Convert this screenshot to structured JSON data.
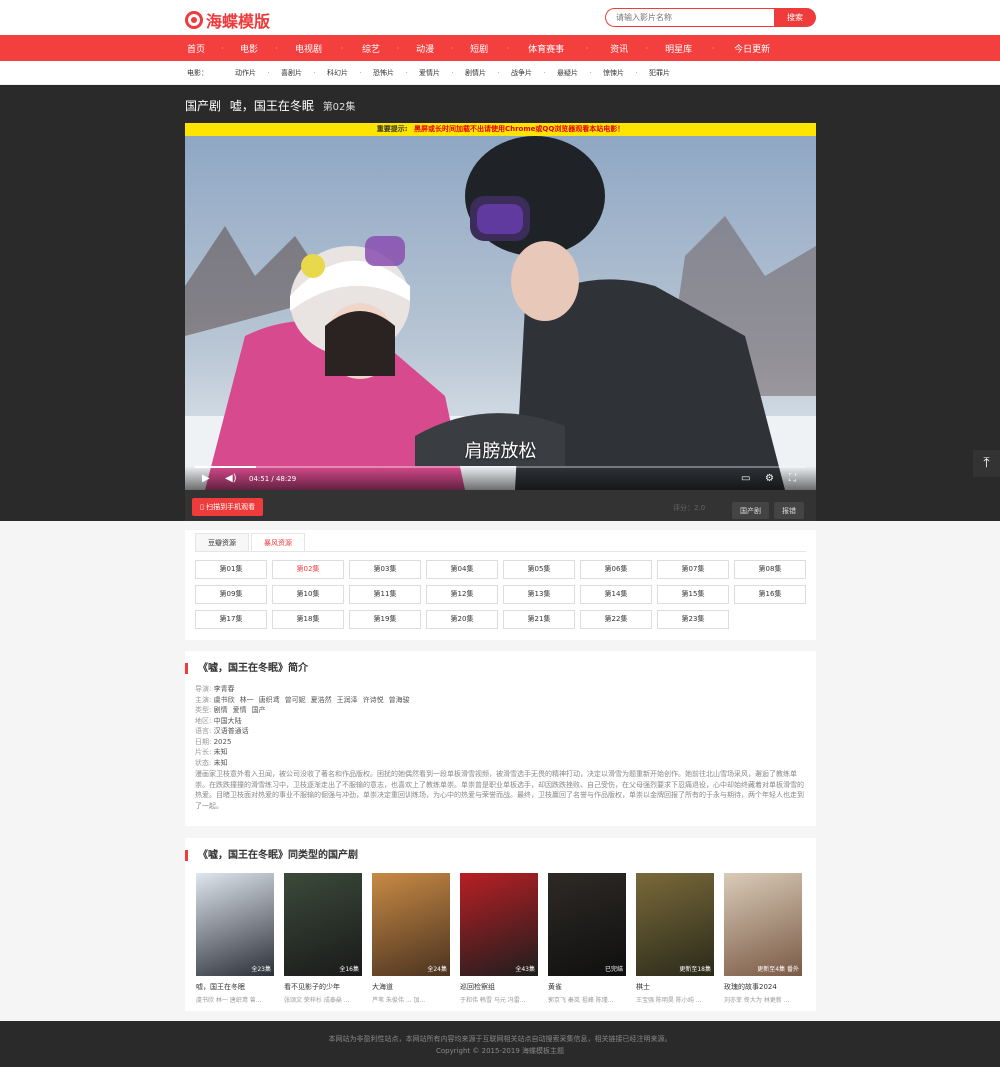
{
  "header": {
    "logo_text": "海蝶模版",
    "search_placeholder": "请输入影片名称",
    "search_button": "搜索"
  },
  "nav": [
    "首页",
    "电影",
    "电视剧",
    "综艺",
    "动漫",
    "短剧",
    "体育赛事",
    "资讯",
    "明星库",
    "今日更新"
  ],
  "subnav": {
    "title": "电影：",
    "items": [
      "动作片",
      "喜剧片",
      "科幻片",
      "恐怖片",
      "爱情片",
      "剧情片",
      "战争片",
      "悬疑片",
      "惊悚片",
      "犯罪片"
    ]
  },
  "player": {
    "category": "国产剧",
    "title": "嘘，国王在冬眠",
    "episode": "第02集",
    "notice_label": "重要提示:",
    "notice_text": "黑屏或长时间加载不出请使用Chrome或QQ浏览器观看本站电影！",
    "subtitle": "肩膀放松",
    "time": "04:51 / 48:29",
    "progress": 0.1,
    "scan_button": "扫描到手机观看",
    "score": "评分：2.0",
    "category_button": "国产剧",
    "report_button": "报错"
  },
  "sources": {
    "tabs": [
      "豆瓣资源",
      "暴风资源"
    ],
    "active_tab": 1
  },
  "episodes": {
    "active": 1,
    "list": [
      "第01集",
      "第02集",
      "第03集",
      "第04集",
      "第05集",
      "第06集",
      "第07集",
      "第08集",
      "第09集",
      "第10集",
      "第11集",
      "第12集",
      "第13集",
      "第14集",
      "第15集",
      "第16集",
      "第17集",
      "第18集",
      "第19集",
      "第20集",
      "第21集",
      "第22集",
      "第23集"
    ]
  },
  "synopsis": {
    "title": "《嘘，国王在冬眠》简介",
    "director_label": "导演:",
    "director": [
      "李青春"
    ],
    "cast_label": "主演:",
    "cast": [
      "虞书欣",
      "林一",
      "唐织鸢",
      "曾可妮",
      "夏浩然",
      "王润泽",
      "许诗悦",
      "曾海骏"
    ],
    "genre_label": "类型:",
    "genre": [
      "剧情",
      "爱情",
      "国产"
    ],
    "region_label": "地区:",
    "region": "中国大陆",
    "language_label": "语言:",
    "language": "汉语普通话",
    "date_label": "日期:",
    "date": "2025",
    "length_label": "片长:",
    "length": "未知",
    "status_label": "状态:",
    "status": "未知",
    "description": "漫画家卫枝意外看入丑闻，被公司没收了著名和作品版权。困扰的她偶然看到一段单板滑雪视频，被滑雪选手无畏的精神打动，决定以滑雪为题重新开始创作。她前往北山雪场采风，邂逅了教练单崇。在跌跌撞撞的滑雪练习中，卫枝逐渐走出了不服输的意志，也喜欢上了教练单崇。单崇曾是职业单板选手，却因跌跌挫败、自己受伤，在父母强烈要求下忍痛退役，心中却始终藏着对单板滑雪的热爱。目睹卫枝面对热爱的事业不服输的倔强与冲劲，单崇决定重回训练场，为心中的热爱与荣誉而战。最终，卫枝赢回了名誉与作品版权，单崇以金牌回报了所有的于永与期待，两个年轻人也走到了一起。"
  },
  "similar": {
    "title": "《嘘，国王在冬眠》同类型的国产剧",
    "items": [
      {
        "title": "嘘，国王在冬眠",
        "badge": "全23集",
        "cast": "虞书欣  林一  唐织鸢  曾...",
        "colors": [
          "#dfe6ee",
          "#2b2f38"
        ]
      },
      {
        "title": "看不见影子的少年",
        "badge": "全16集",
        "cast": "张颂文  荣梓杉  成泰燊  ...",
        "colors": [
          "#3b4a3a",
          "#1a1a1a"
        ]
      },
      {
        "title": "大海道",
        "badge": "全24集",
        "cast": "芦苇  朱俊伟  ...  加...",
        "colors": [
          "#c88a45",
          "#4a3320"
        ]
      },
      {
        "title": "巡回检察组",
        "badge": "全43集",
        "cast": "于和伟  韩雪  马元  冯雷...",
        "colors": [
          "#b81f24",
          "#1e1e1e"
        ]
      },
      {
        "title": "黄雀",
        "badge": "已完结",
        "cast": "郭京飞  秦岚  祖峰  陈瑾...",
        "colors": [
          "#2e2a26",
          "#0f0f0f"
        ]
      },
      {
        "title": "棋士",
        "badge": "更新至18集",
        "cast": "王宝强  陈明昊  陈小纯  ...",
        "colors": [
          "#7a6a3a",
          "#2a2a1a"
        ]
      },
      {
        "title": "玫瑰的故事2024",
        "badge": "更新至4集 番外",
        "cast": "刘亦菲  佟大为  林更新  ...",
        "colors": [
          "#d9cbb8",
          "#7a5a45"
        ]
      }
    ]
  },
  "footer": {
    "line1": "本网站为非盈利性站点，本网站所有内容均来源于互联网相关站点自动搜索采集信息，相关链接已经注明来源。",
    "line2": "Copyright © 2015-2019 海蝶模板主题"
  },
  "to_top_icon": "arrow-up-to-top-icon",
  "accent": "#ee3b3b"
}
